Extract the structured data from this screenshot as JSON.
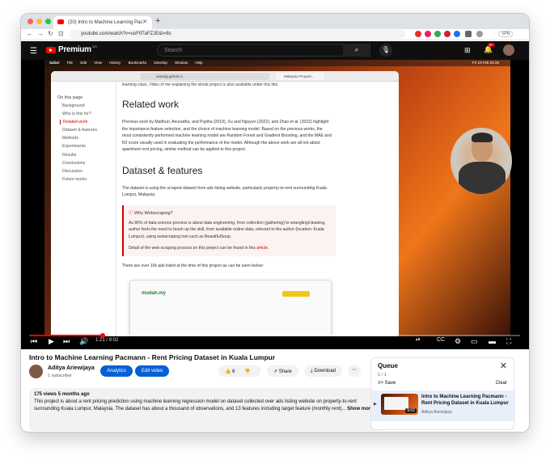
{
  "browser": {
    "tab_title": "(20) Intro to Machine Learning Pac",
    "url": "youtube.com/watch?v=uoFtf7aFZJE&t=8s",
    "vpn": "VPN"
  },
  "youtube": {
    "brand": "Premium",
    "region": "NG",
    "search_placeholder": "Search",
    "notification_count": "9+"
  },
  "video": {
    "screen": {
      "mac_menu": [
        "Safari",
        "File",
        "Edit",
        "View",
        "History",
        "Bookmarks",
        "Develop",
        "Window",
        "Help"
      ],
      "mac_clock": "Fri 10 Feb 20:26",
      "safari_url": "ariewijy.github.io",
      "safari_tab": "Malaysia Propert...",
      "toc_title": "On this page",
      "toc": [
        "Background",
        "Who is this for?",
        "Related work",
        "Dataset & features",
        "Methods",
        "Experiments",
        "Results",
        "Conclusions",
        "Discussion",
        "Future works"
      ],
      "top_line": "learning class. Video of me explaining the whole project is also available under this link.",
      "h_related": "Related work",
      "related_text": "Previous work by Madhuri, Anuradha, and Pujitha (2019), Xu and Nguyen (2022), and Zhao et al. (2022) highlight the importance feature selection, and the choice of machine learning model. Based on the previous works, the most consistently performed machine learning model are Random Forest and Gradient Boosting, and the MAE and R2 score usually used in evaluating the performance of the model. Although the above work are all not about apartment rent pricing, similar method can be applied to this project.",
      "h_dataset": "Dataset & features",
      "dataset_text": "The dataset is using the scraped dataset from ads listing website, particularly property-to-rent surrounding Kuala Lumpur, Malaysia.",
      "callout_title": "Why Webscraping?",
      "callout_text": "As 80% of data science process is about data engineering, from collection (gathering) to wrangling/cleaning, author feels the need to brush up the skill, from available online data, relevant to the author (location: Kuala Lumpur), using webscraping tool such as BeautifulSoup.",
      "callout_detail_prefix": "Detail of the web-scraping process on this project can be found in this",
      "callout_detail_link": "article",
      "ads_text": "There are over 10k ads listed at the time of this project as can be seen below:",
      "mudah": "mudah.my"
    },
    "time": "1:21 / 9:02",
    "progress": 0.15,
    "title": "Intro to Machine Learning Pacmann - Rent Pricing Dataset in Kuala Lumpur",
    "channel": "Aditya Ariewijaya",
    "subscribers": "1 subscriber",
    "analytics_label": "Analytics",
    "edit_label": "Edit video",
    "likes": "6",
    "share_label": "Share",
    "download_label": "Download",
    "stats": "175 views  5 months ago",
    "description": "This project is about a rent pricing prediction using machine learning regression model on dataset collected over ads listing website on property-to-rent surrounding Kuala Lumpur, Malaysia. The dataset has about a thousand of observations, and 13 features including target feature (monthly rent)...",
    "show_more": "Show more"
  },
  "queue": {
    "title": "Queue",
    "count": "1 / 1",
    "save_label": "Save",
    "clear_label": "Clear",
    "item_title": "Intro to Machine Learning Pacmann - Rent Pricing Dataset in Kuala Lumpur",
    "item_channel": "Aditya Ariewijaya",
    "item_duration": "9:02"
  }
}
